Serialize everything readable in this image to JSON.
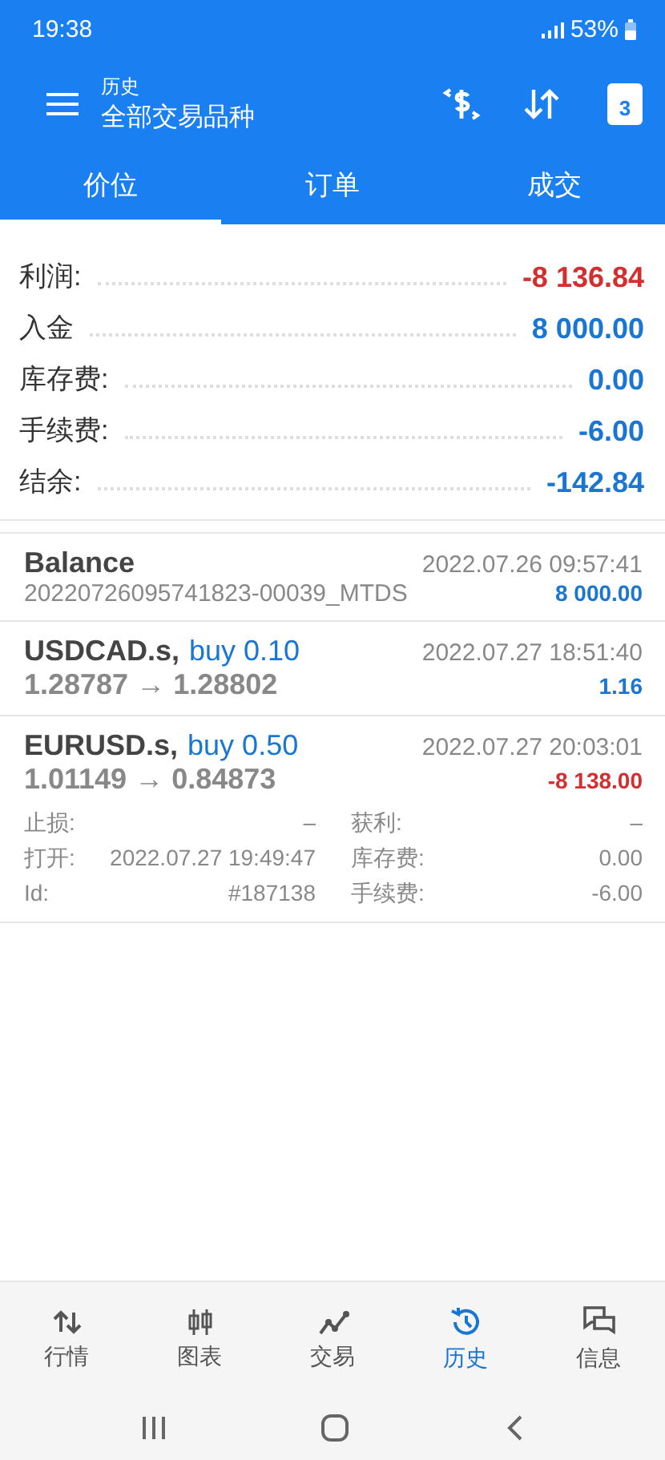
{
  "status_bar": {
    "time": "19:38",
    "battery": "53%"
  },
  "app_bar": {
    "subtitle": "历史",
    "title": "全部交易品种",
    "calendar_day": "3"
  },
  "tabs": [
    {
      "label": "价位",
      "selected": true
    },
    {
      "label": "订单",
      "selected": false
    },
    {
      "label": "成交",
      "selected": false
    }
  ],
  "summary": [
    {
      "label": "利润:",
      "value": "-8 136.84",
      "negative": true
    },
    {
      "label": "入金",
      "value": "8 000.00",
      "negative": false
    },
    {
      "label": "库存费:",
      "value": "0.00",
      "negative": false
    },
    {
      "label": "手续费:",
      "value": "-6.00",
      "negative": false
    },
    {
      "label": "结余:",
      "value": "-142.84",
      "negative": false
    }
  ],
  "entries": [
    {
      "kind": "balance",
      "title": "Balance",
      "time": "2022.07.26 09:57:41",
      "comment": "20220726095741823-00039_MTDS",
      "amount": "8 000.00",
      "negative": false,
      "expanded": false
    },
    {
      "kind": "trade",
      "title": "USDCAD.s,",
      "side": "buy 0.10",
      "time": "2022.07.27 18:51:40",
      "prices": "1.28787 → 1.28802",
      "amount": "1.16",
      "negative": false,
      "expanded": false
    },
    {
      "kind": "trade",
      "title": "EURUSD.s,",
      "side": "buy 0.50",
      "time": "2022.07.27 20:03:01",
      "prices": "1.01149 → 0.84873",
      "amount": "-8 138.00",
      "negative": true,
      "expanded": true,
      "details": [
        {
          "label": "止损:",
          "value": "–"
        },
        {
          "label": "获利:",
          "value": "–"
        },
        {
          "label": "打开:",
          "value": "2022.07.27 19:49:47"
        },
        {
          "label": "库存费:",
          "value": "0.00"
        },
        {
          "label": "Id:",
          "value": "#187138"
        },
        {
          "label": "手续费:",
          "value": "-6.00"
        }
      ]
    }
  ],
  "bottom_nav": [
    {
      "kind": "quotes",
      "label": "行情",
      "selected": false
    },
    {
      "kind": "chart",
      "label": "图表",
      "selected": false
    },
    {
      "kind": "trade",
      "label": "交易",
      "selected": false
    },
    {
      "kind": "history",
      "label": "历史",
      "selected": true
    },
    {
      "kind": "messages",
      "label": "信息",
      "selected": false
    }
  ]
}
